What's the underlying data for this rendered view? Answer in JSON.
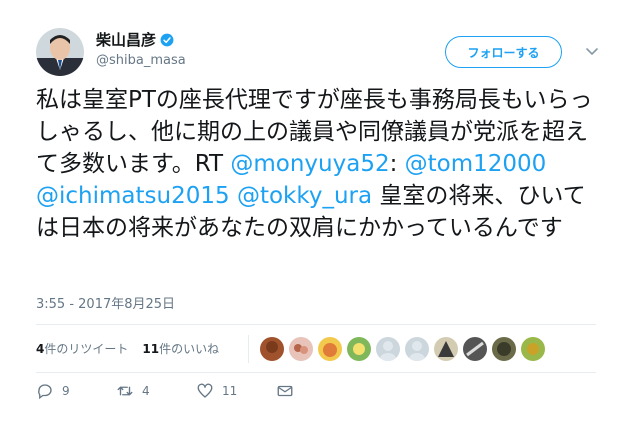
{
  "user": {
    "name": "柴山昌彦",
    "handle": "@shiba_masa",
    "verified": true
  },
  "follow_button": {
    "label": "フォローする"
  },
  "tweet": {
    "segments": [
      {
        "text": "私は皇室PTの座長代理ですが座長も事務局長もいらっしゃるし、他に期の上の議員や同僚議員が党派を超えて多数います。RT ",
        "link": false
      },
      {
        "text": "@monyuya52",
        "link": true
      },
      {
        "text": ": ",
        "link": false
      },
      {
        "text": "@tom12000",
        "link": true
      },
      {
        "text": " ",
        "link": false
      },
      {
        "text": "@ichimatsu2015",
        "link": true
      },
      {
        "text": " ",
        "link": false
      },
      {
        "text": "@tokky_ura",
        "link": true
      },
      {
        "text": " 皇室の将来、ひいては日本の将来があなたの双肩にかかっているんです",
        "link": false
      }
    ],
    "timestamp": "3:55 - 2017年8月25日"
  },
  "stats": {
    "retweets_count": "4",
    "retweets_label": "件のリツイート",
    "likes_count": "11",
    "likes_label": "件のいいね"
  },
  "actions": {
    "reply_count": "9",
    "retweet_count": "4",
    "like_count": "11"
  },
  "colors": {
    "link": "#1da1f2",
    "verified": "#1da1f2",
    "muted": "#657786",
    "text": "#14171a"
  },
  "likers": [
    "avatar-1",
    "avatar-2",
    "avatar-3",
    "avatar-4",
    "avatar-5",
    "avatar-6",
    "avatar-7",
    "avatar-8",
    "avatar-9",
    "avatar-10"
  ]
}
